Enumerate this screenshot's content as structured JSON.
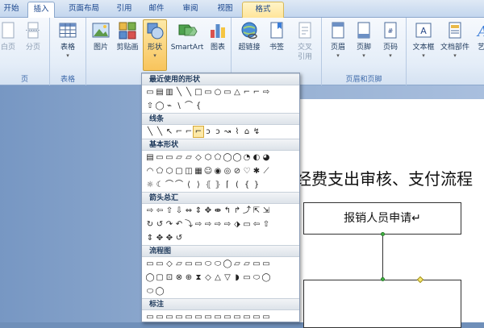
{
  "tabs": [
    {
      "id": "start",
      "label": "开始"
    },
    {
      "id": "insert",
      "label": "插入",
      "active": true
    },
    {
      "id": "layout",
      "label": "页面布局"
    },
    {
      "id": "ref",
      "label": "引用"
    },
    {
      "id": "mail",
      "label": "邮件"
    },
    {
      "id": "review",
      "label": "审阅"
    },
    {
      "id": "view",
      "label": "视图"
    },
    {
      "id": "format",
      "label": "格式",
      "contextual": true
    }
  ],
  "ribbon": {
    "groups": {
      "pages": "页",
      "tables": "表格",
      "links": "链接",
      "header_footer": "页眉和页脚"
    },
    "buttons": {
      "blank_page": "白页",
      "page_break": "分页",
      "table": "表格",
      "picture": "图片",
      "clipart": "剪贴画",
      "shapes": "形状",
      "smartart": "SmartArt",
      "chart": "图表",
      "hyperlink": "超链接",
      "bookmark": "书签",
      "crossref_1": "交叉",
      "crossref_2": "引用",
      "header": "页眉",
      "footer": "页脚",
      "page_number": "页码",
      "textbox": "文本框",
      "quickparts": "文档部件",
      "wordart": "艺术"
    },
    "dropdown_arrow": "▾"
  },
  "shapes_panel": {
    "sections": [
      {
        "title": "最近使用的形状",
        "rows": [
          [
            "▭",
            "▤",
            "▥",
            "╲",
            "╲",
            "□",
            "▭",
            "○",
            "▭",
            "△",
            "⌐",
            "⌐",
            "⇨"
          ],
          [
            "⇧",
            "◯",
            "⌁",
            "\\",
            "⌒",
            "{"
          ]
        ]
      },
      {
        "title": "线条",
        "rows": [
          [
            "╲",
            "╲",
            "↖",
            "⌐",
            "⌐",
            "⌐",
            "ↄ",
            "ↄ",
            "↝",
            "⌇",
            "⌂",
            "↯"
          ]
        ]
      },
      {
        "title": "基本形状",
        "rows": [
          [
            "▤",
            "▭",
            "▭",
            "▱",
            "▱",
            "◇",
            "⬡",
            "⬠",
            "◯",
            "◯",
            "◔",
            "◐",
            "◕"
          ],
          [
            "◠",
            "⬠",
            "⬡",
            "▢",
            "◫",
            "▦",
            "☺",
            "◉",
            "◎",
            "⊘",
            "♡",
            "✱",
            "⟋"
          ],
          [
            "☼",
            "☾",
            "⌒",
            "⌒",
            "⟨",
            "⟩",
            "⦃",
            "⦄",
            "⌈",
            "(",
            "{",
            "}"
          ]
        ]
      },
      {
        "title": "箭头总汇",
        "rows": [
          [
            "⇨",
            "⇦",
            "⇧",
            "⇩",
            "⇔",
            "⇕",
            "✥",
            "⇼",
            "↰",
            "↱",
            "⤴",
            "⇱",
            "⇲"
          ],
          [
            "↻",
            "↺",
            "↷",
            "↶",
            "⤵",
            "⇨",
            "⇨",
            "⇨",
            "⇨",
            "⬗",
            "▭",
            "⇦",
            "⇧"
          ],
          [
            "⇕",
            "✥",
            "✥",
            "↺"
          ]
        ]
      },
      {
        "title": "流程图",
        "rows": [
          [
            "▭",
            "▭",
            "◇",
            "▱",
            "▭",
            "▭",
            "⬭",
            "⬭",
            "◯",
            "▱",
            "▱",
            "▭",
            "▭"
          ],
          [
            "◯",
            "▢",
            "⊡",
            "⊗",
            "⊕",
            "⧗",
            "◇",
            "△",
            "▽",
            "◗",
            "▭",
            "⬭",
            "◯"
          ],
          [
            "⬭",
            "◯"
          ]
        ]
      },
      {
        "title": "标注",
        "rows": [
          [
            "▭",
            "▭",
            "▭",
            "▭",
            "▭",
            "▭",
            "▭",
            "▭",
            "▭",
            "▭",
            "▭",
            "▭",
            "▭"
          ]
        ]
      }
    ]
  },
  "document": {
    "heading": "经费支出审核、支付流程",
    "box1_text": "报销人员申请↵"
  },
  "colors": {
    "accent": "#15428b",
    "selected_shape": "#fde9a8",
    "connector_point": "#3fb540",
    "adjust_handle": "#f6e66a"
  }
}
